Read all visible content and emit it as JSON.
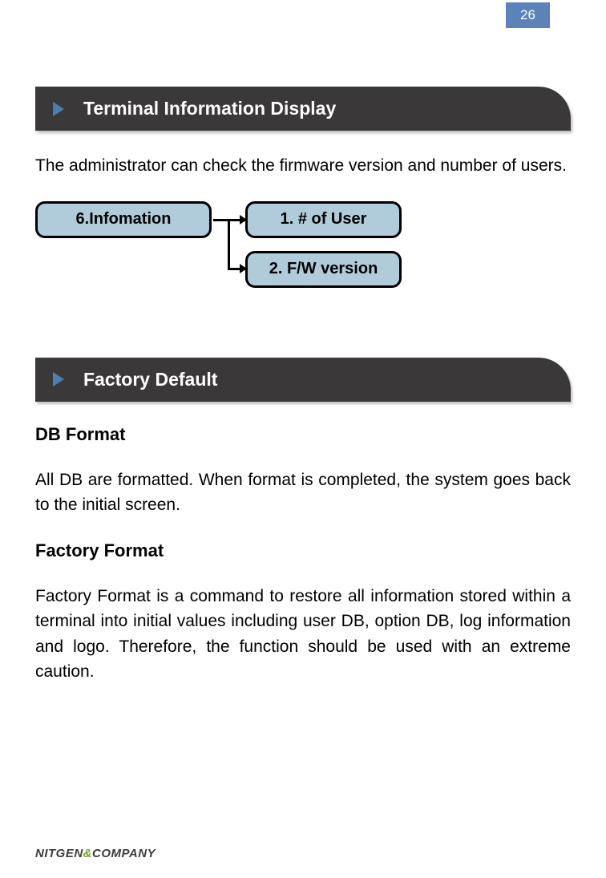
{
  "page_number": "26",
  "section1": {
    "title": "Terminal Information Display",
    "intro": "The administrator can check the firmware version and number of users."
  },
  "diagram": {
    "parent": "6.Infomation",
    "child1": "1. # of User",
    "child2": "2. F/W version"
  },
  "section2": {
    "title": "Factory Default",
    "sub1_title": "DB Format",
    "sub1_body": " All DB are formatted. When format is completed, the system goes back to the initial screen.",
    "sub2_title": "Factory Format",
    "sub2_body": "Factory Format is a command to restore all information stored within a terminal into initial values including user DB, option DB, log information and logo. Therefore, the function should be used with an extreme caution."
  },
  "footer": {
    "b1": "NITGEN",
    "amp": "&",
    "b2": "COMPANY"
  }
}
